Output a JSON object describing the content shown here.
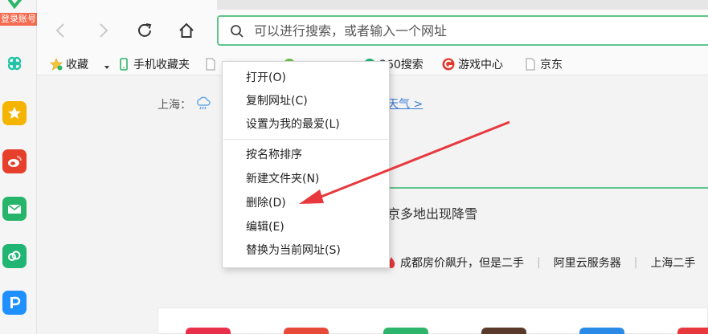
{
  "sidebar": {
    "login_label": "登录账号",
    "icons": [
      {
        "name": "pinwheel-icon",
        "color": "#22c3a6"
      },
      {
        "name": "star-icon",
        "color": "#f5b400"
      },
      {
        "name": "weibo-icon",
        "color": "#e6402c"
      },
      {
        "name": "mail-icon",
        "color": "#26b56b"
      },
      {
        "name": "cloud-icon",
        "color": "#20b573"
      },
      {
        "name": "p-icon",
        "color": "#1e90ff"
      }
    ]
  },
  "address_bar": {
    "placeholder": "可以进行搜索，或者输入一个网址"
  },
  "bookmarks": {
    "favorites": "收藏",
    "phone_favorites": "手机收藏夹",
    "search360": "360搜索",
    "game_center": "游戏中心",
    "jd": "京东"
  },
  "weather": {
    "city": "上海：",
    "link": "天气 >"
  },
  "news": {
    "headline": "京多地出现降雪",
    "ticker": [
      "成都房价飙升，但是二手",
      "阿里云服务器",
      "上海二手"
    ]
  },
  "context_menu": {
    "items": [
      "打开(O)",
      "复制网址(C)",
      "设置为我的最爱(L)",
      "按名称排序",
      "新建文件夹(N)",
      "删除(D)",
      "编辑(E)",
      "替换为当前网址(S)"
    ]
  },
  "colors": {
    "accent_green": "#5ec58b",
    "annotation_red": "#e8383d",
    "link_blue": "#3a7bd5"
  }
}
